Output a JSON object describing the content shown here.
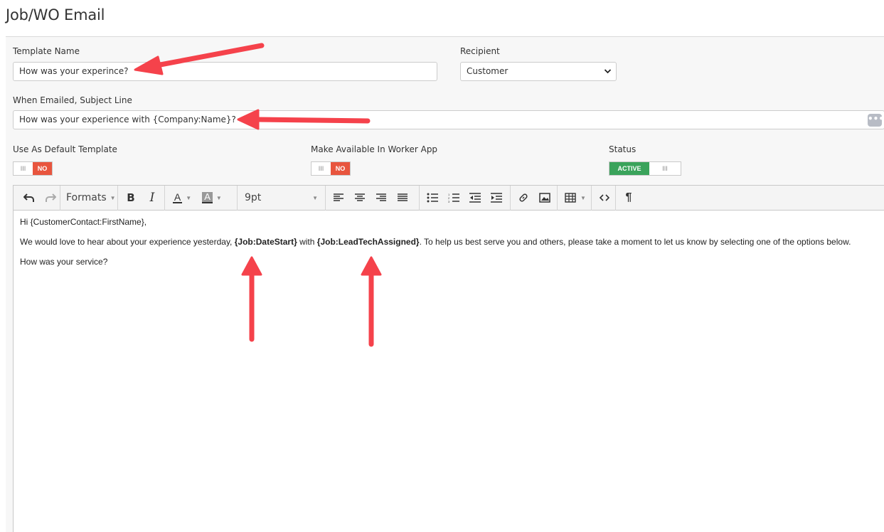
{
  "page": {
    "title": "Job/WO Email"
  },
  "form": {
    "template_name": {
      "label": "Template Name",
      "value": "How was your experince?"
    },
    "recipient": {
      "label": "Recipient",
      "value": "Customer"
    },
    "subject": {
      "label": "When Emailed, Subject Line",
      "value": "How was your experience with {Company:Name}?",
      "more_label": "•••"
    },
    "default_template": {
      "label": "Use As Default Template",
      "state": "NO",
      "grip": "III"
    },
    "worker_app": {
      "label": "Make Available In Worker App",
      "state": "NO",
      "grip": "III"
    },
    "status": {
      "label": "Status",
      "state": "ACTIVE",
      "grip": "III"
    }
  },
  "toolbar": {
    "formats_label": "Formats",
    "font_size": "9pt",
    "icons": [
      "undo-icon",
      "redo-icon",
      "bold-icon",
      "italic-icon",
      "font-color-icon",
      "background-color-icon",
      "align-left-icon",
      "align-center-icon",
      "align-right-icon",
      "align-justify-icon",
      "bullet-list-icon",
      "numbered-list-icon",
      "outdent-icon",
      "indent-icon",
      "link-icon",
      "image-icon",
      "table-icon",
      "source-code-icon",
      "paragraph-icon"
    ]
  },
  "editor": {
    "greeting": "Hi {CustomerContact:FirstName},",
    "body_before": "We would love to hear about your experience yesterday, ",
    "token_date": "{Job:DateStart}",
    "body_with": " with ",
    "token_tech": "{Job:LeadTechAssigned}",
    "body_after": ". To help us best serve you and others, please take a moment to let us know by selecting one of the options below.",
    "question": "How was your service?"
  },
  "colors": {
    "no_red": "#e8553e",
    "active_green": "#3aa35b",
    "annotation_arrow": "#f5424b"
  }
}
